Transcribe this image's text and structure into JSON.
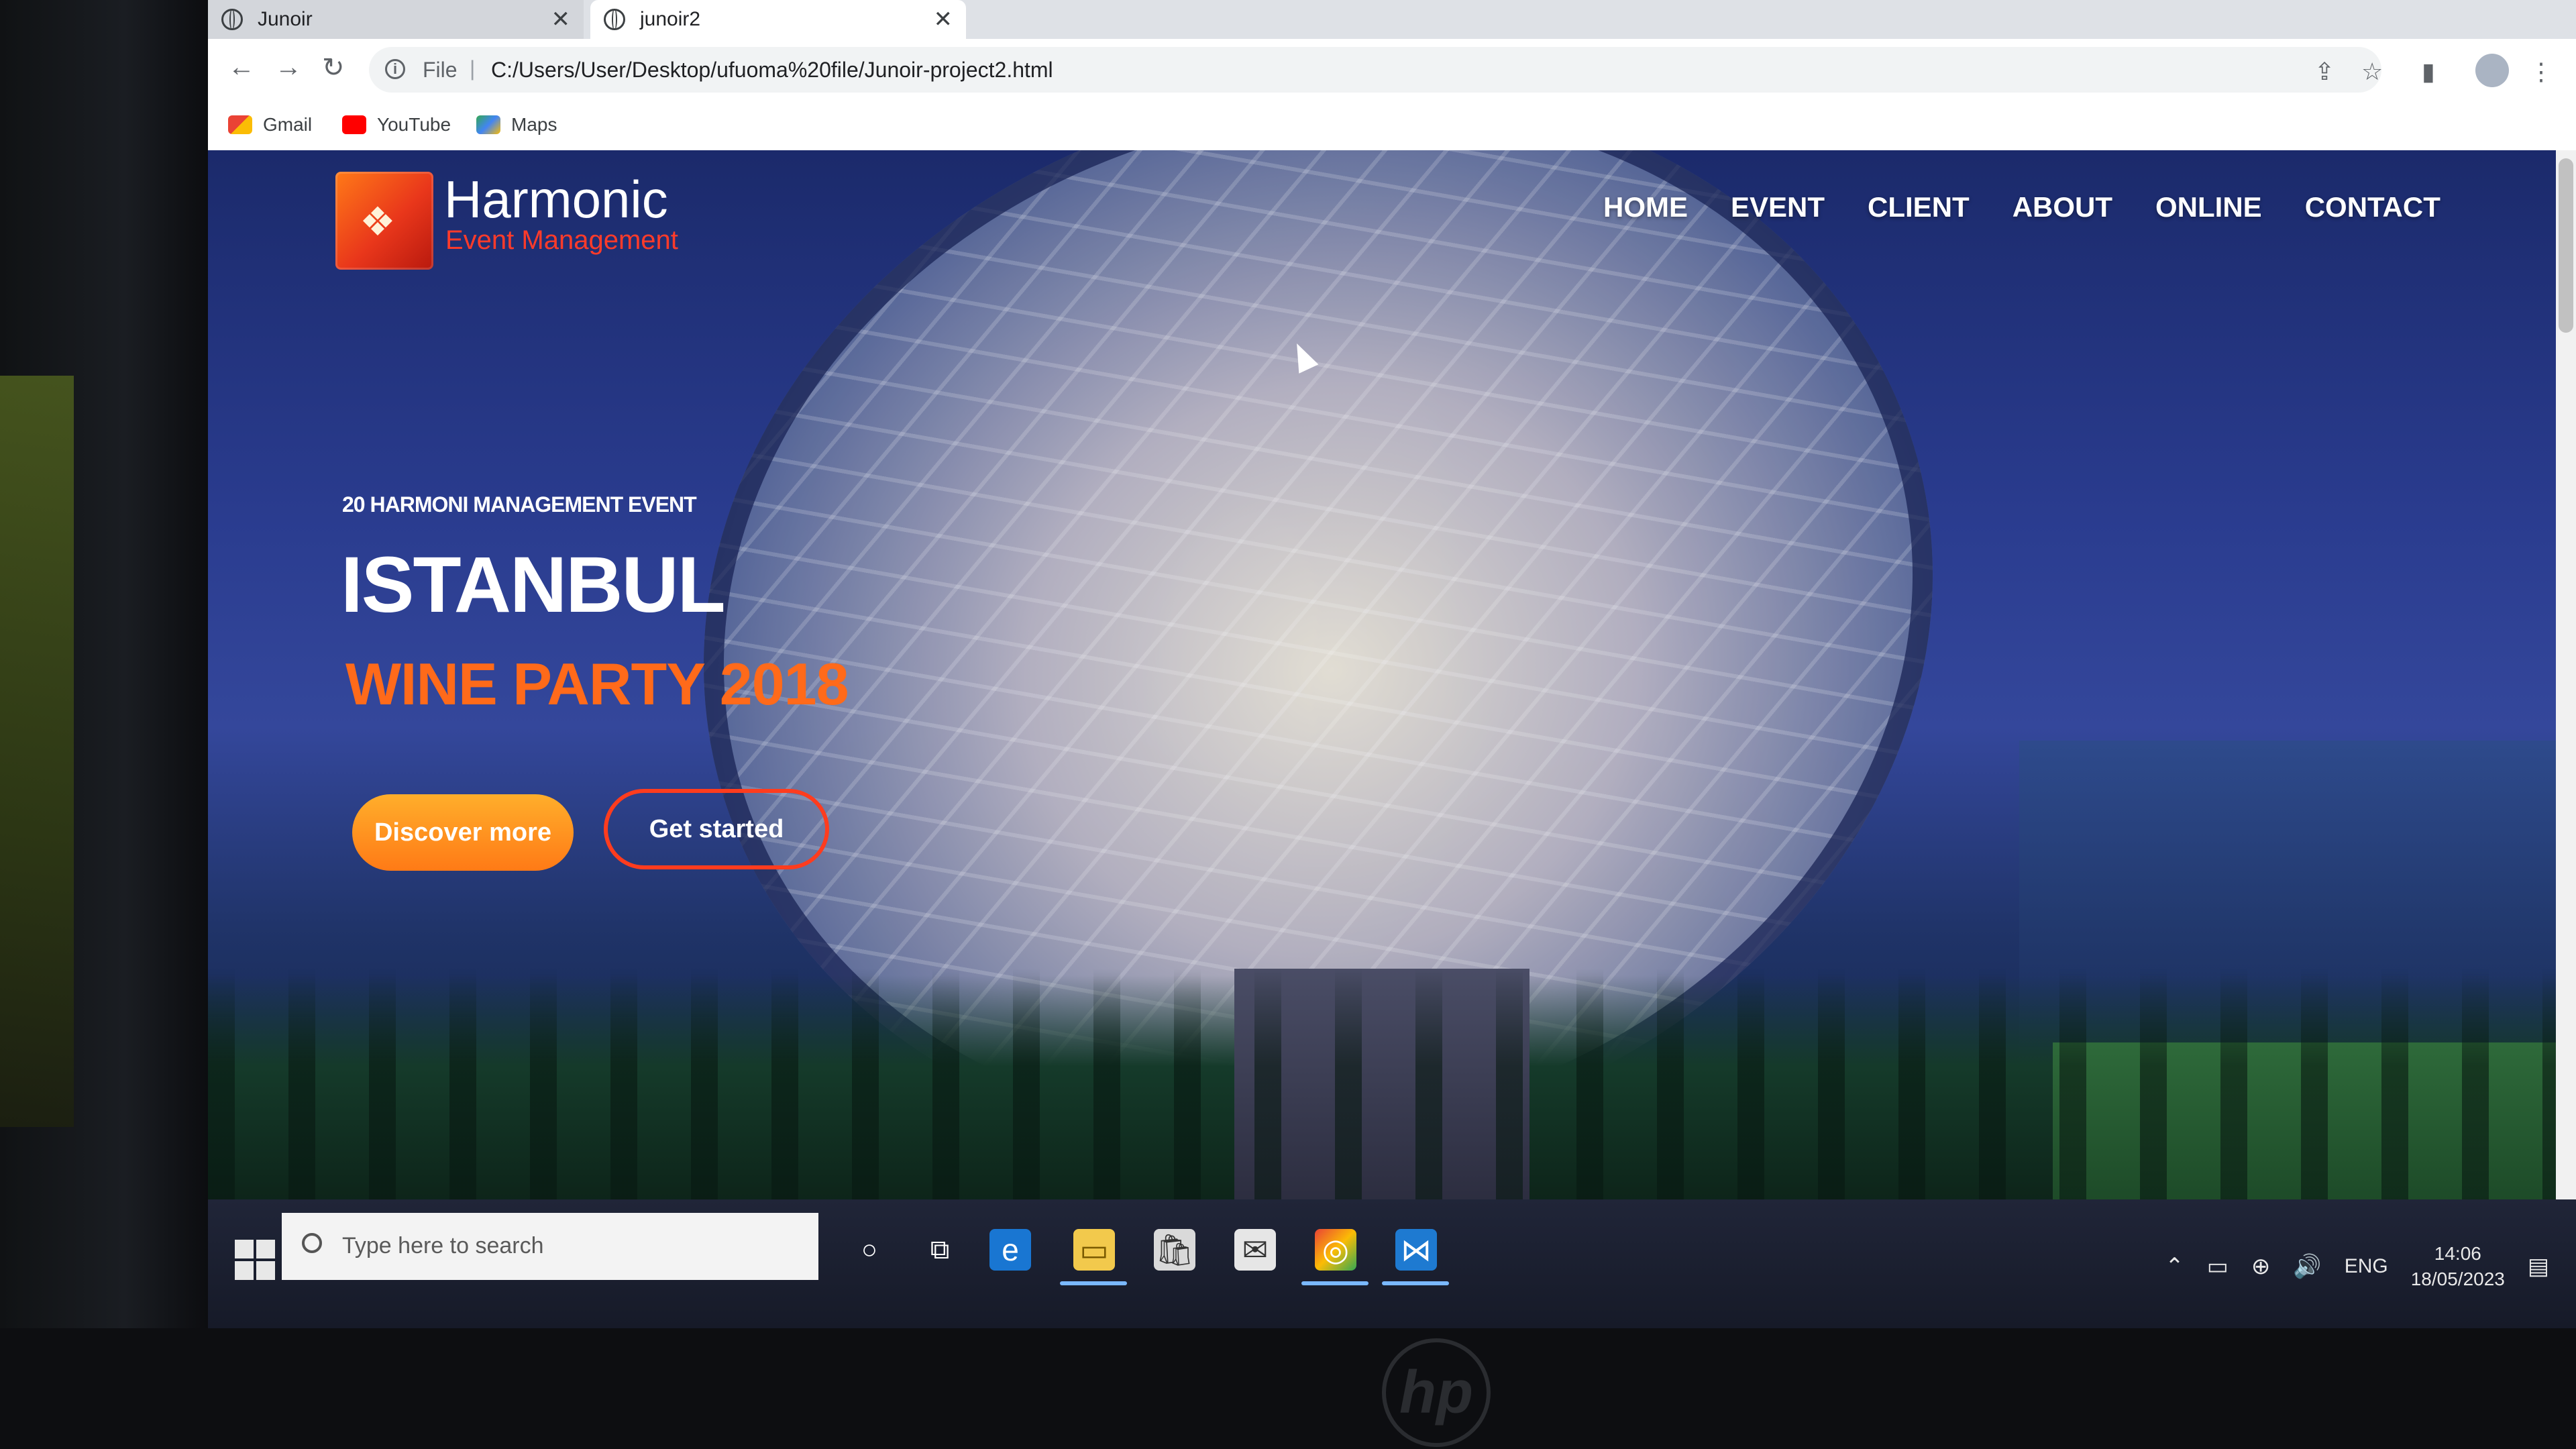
{
  "browser": {
    "tabs": [
      {
        "label": "Junoir",
        "close": "✕"
      },
      {
        "label": "junoir2",
        "close": "✕"
      }
    ],
    "url_scheme": "File",
    "url_separator": "|",
    "url_path": "C:/Users/User/Desktop/ufuoma%20file/Junoir-project2.html",
    "bookmarks": [
      "Gmail",
      "YouTube",
      "Maps"
    ]
  },
  "site": {
    "brand_name": "Harmonic",
    "brand_tagline": "Event Management",
    "nav": [
      "HOME",
      "EVENT",
      "CLIENT",
      "ABOUT",
      "ONLINE",
      "CONTACT"
    ],
    "hero": {
      "eyebrow": "20 HARMONI MANAGEMENT EVENT",
      "title": "ISTANBUL",
      "subtitle": "WINE PARTY 2018",
      "primary_cta": "Discover more",
      "secondary_cta": "Get started"
    }
  },
  "taskbar": {
    "search_placeholder": "Type here to search",
    "language": "ENG",
    "time": "14:06",
    "date": "18/05/2023"
  },
  "device": {
    "brand": "hp"
  },
  "colors": {
    "accent_orange": "#ff7a16",
    "brand_red": "#ff3b2a",
    "hero_blue": "#2a3c8f"
  }
}
